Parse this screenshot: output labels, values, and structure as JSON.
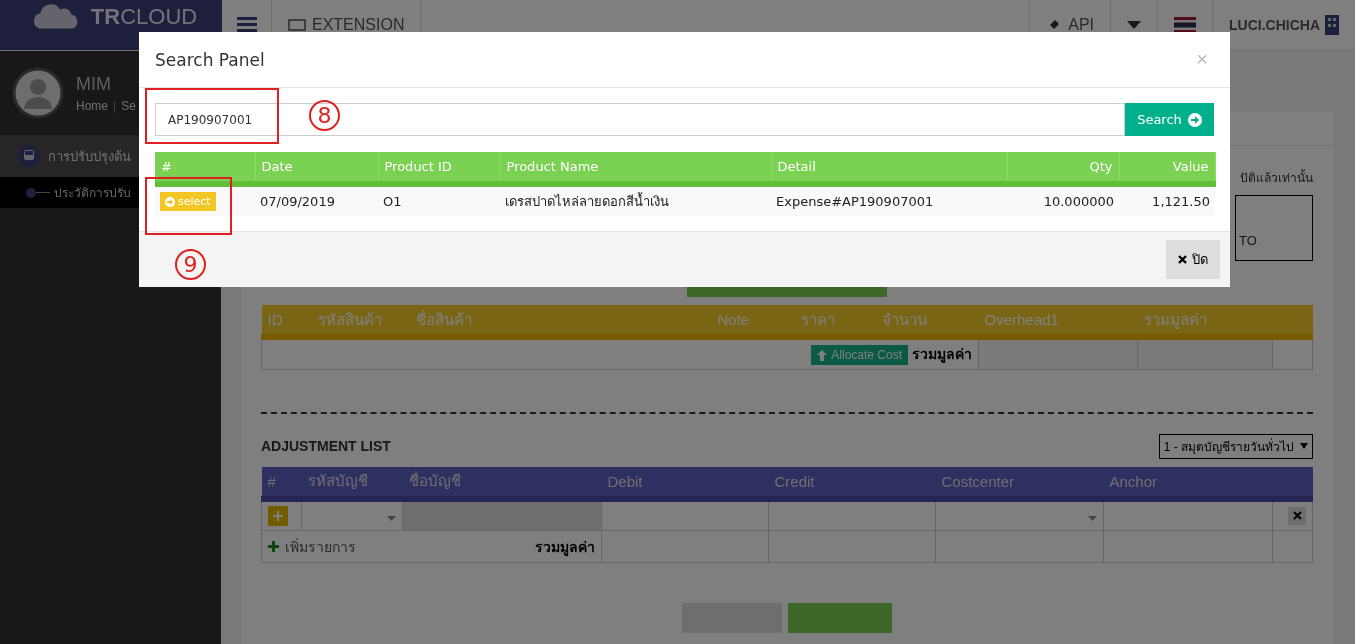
{
  "topbar": {
    "logo": "**TR**CLOUD",
    "nav_item": "EXTENSION",
    "api": "API",
    "user": "LUCI.CHICHA"
  },
  "sidebar": {
    "name": "MIM",
    "breadcrumb": [
      "Home",
      "Se"
    ],
    "breadcrumb_separator": "|",
    "menu": [
      {
        "label": "การปรับปรุงต้น",
        "expanded": true,
        "children": [
          {
            "label": "ประวัติการปรับ",
            "selected": true
          }
        ]
      }
    ]
  },
  "content": {
    "notice": "ปัติแล้วเท่านั้น",
    "box_text": "TO",
    "cost_table": {
      "columns": [
        "ID",
        "รหัสสินค้า",
        "ชื่อสินค้า",
        "Note",
        "ราคา",
        "จำนวน",
        "Overhead1",
        "รวมมูลค่า"
      ],
      "allocate_button": "Allocate Cost",
      "total_label": "รวมมูลค่า"
    },
    "adjustment": {
      "title": "ADJUSTMENT LIST",
      "journal": "1 - สมุดบัญชีรายวันทั่วไป",
      "columns": [
        "#",
        "รหัสบัญชี",
        "ชื่อบัญชี",
        "Debit",
        "Credit",
        "Costcenter",
        "Anchor"
      ],
      "add_item": "เพิ่มรายการ",
      "total_label": "รวมมูลค่า"
    }
  },
  "modal": {
    "title": "Search Panel",
    "close": "×",
    "search_value": "AP190907001",
    "search_button": "Search",
    "columns": [
      "#",
      "Date",
      "Product ID",
      "Product Name",
      "Detail",
      "Qty",
      "Value"
    ],
    "rows": [
      {
        "action": "select",
        "date": "07/09/2019",
        "product_id": "O1",
        "product_name": "เดรสปาดไหล่ลายดอกสีน้ำเงิน",
        "detail": "Expense#AP190907001",
        "qty": "10.000000",
        "value": "1,121.50"
      }
    ],
    "close_button": "ปิด",
    "annotations": [
      {
        "label": "8"
      },
      {
        "label": "9"
      }
    ]
  }
}
